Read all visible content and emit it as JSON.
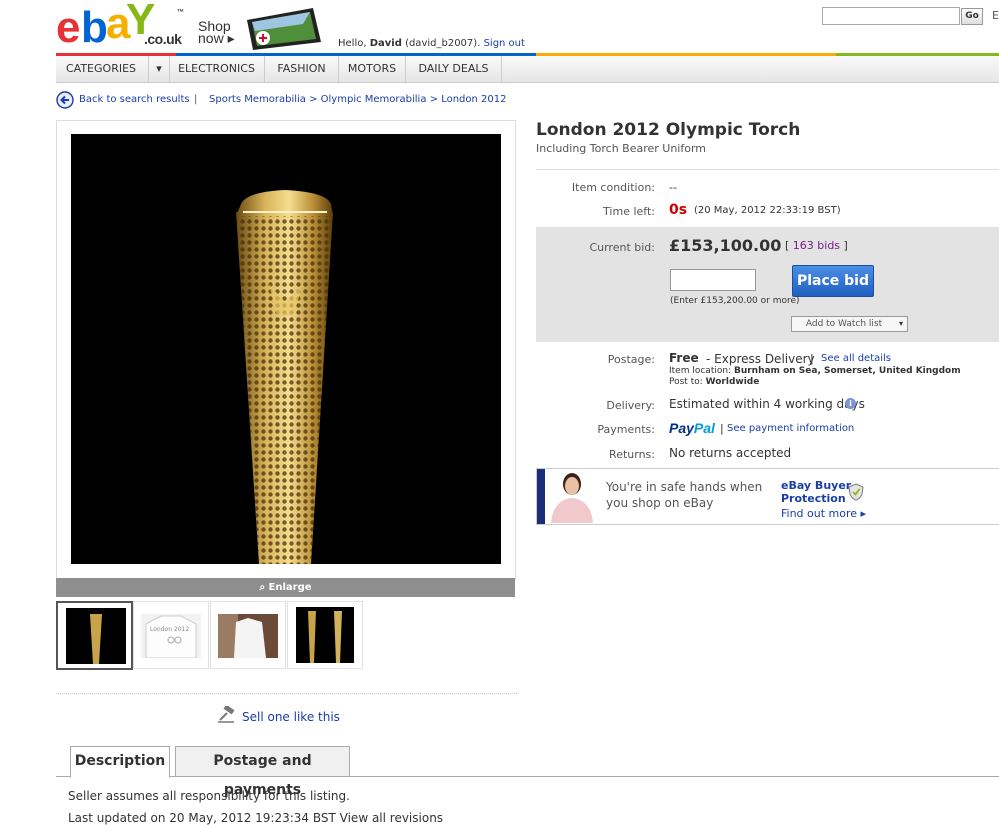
{
  "header": {
    "logo_letters": [
      "e",
      "b",
      "a",
      "Y"
    ],
    "logo_colors": [
      "#e53238",
      "#0064d2",
      "#f5af02",
      "#86b817"
    ],
    "logo_tm": "™",
    "logo_domain": ".co.uk",
    "shop_now": [
      "Shop",
      "now ▸"
    ],
    "greeting_prefix": "Hello,",
    "user_name": "David",
    "user_id": "(david_b2007).",
    "sign_out": "Sign out",
    "search_value": "",
    "go_label": "Go",
    "cut_char": "E"
  },
  "nav": {
    "items": [
      "CATEGORIES",
      "▾",
      "ELECTRONICS",
      "FASHION",
      "MOTORS",
      "DAILY DEALS"
    ]
  },
  "breadcrumb": {
    "back": "Back to search results",
    "separator": "|",
    "path": "Sports Memorabilia > Olympic Memorabilia > London 2012"
  },
  "gallery": {
    "enlarge": "Enlarge",
    "thumb_text": "London 2012"
  },
  "sell_one": "Sell one like this",
  "tabs": [
    "Description",
    "Postage and payments"
  ],
  "description": {
    "line1": "Seller assumes all responsibility for this listing.",
    "line2": "Last updated on 20 May, 2012 19:23:34 BST View all revisions"
  },
  "item": {
    "title": "London 2012 Olympic Torch",
    "subtitle": "Including Torch Bearer Uniform",
    "condition_label": "Item condition:",
    "condition_value": "--",
    "time_left_label": "Time left:",
    "time_left": "0s",
    "end_date": "(20 May, 2012 22:33:19 BST)",
    "current_bid_label": "Current bid:",
    "current_bid": "£153,100.00",
    "bids_open": "[",
    "bids_count": "163 bids",
    "bids_close": "]",
    "bid_input_value": "",
    "place_bid": "Place bid",
    "enter_hint": "(Enter £153,200.00 or more)",
    "watch_list": "Add to Watch list",
    "watch_arrow": "▾",
    "postage_label": "Postage:",
    "postage_free": "Free",
    "postage_service": "- Express Delivery",
    "pipe": "|",
    "see_all": "See all details",
    "location_label": "Item location:",
    "location_value": "Burnham on Sea, Somerset, United Kingdom",
    "post_to_label": "Post to:",
    "post_to_value": "Worldwide",
    "delivery_label": "Delivery:",
    "delivery_value": "Estimated within 4 working days",
    "info_icon": "i",
    "payments_label": "Payments:",
    "paypal_pay": "Pay",
    "paypal_pal": "Pal",
    "see_payment": "See payment information",
    "returns_label": "Returns:",
    "returns_value": "No returns accepted"
  },
  "protection": {
    "line1": "You're in safe hands when",
    "line2": "you shop on eBay",
    "title1": "eBay Buyer",
    "title2": "Protection",
    "find_out": "Find out more ▸"
  },
  "colors": {
    "link": "#1a3ea6",
    "time_left": "#cc0000",
    "bid_button": "#1f5fbf",
    "paypal_dark": "#003087",
    "paypal_light": "#009cde",
    "bid_box": "#e3e3e3"
  }
}
